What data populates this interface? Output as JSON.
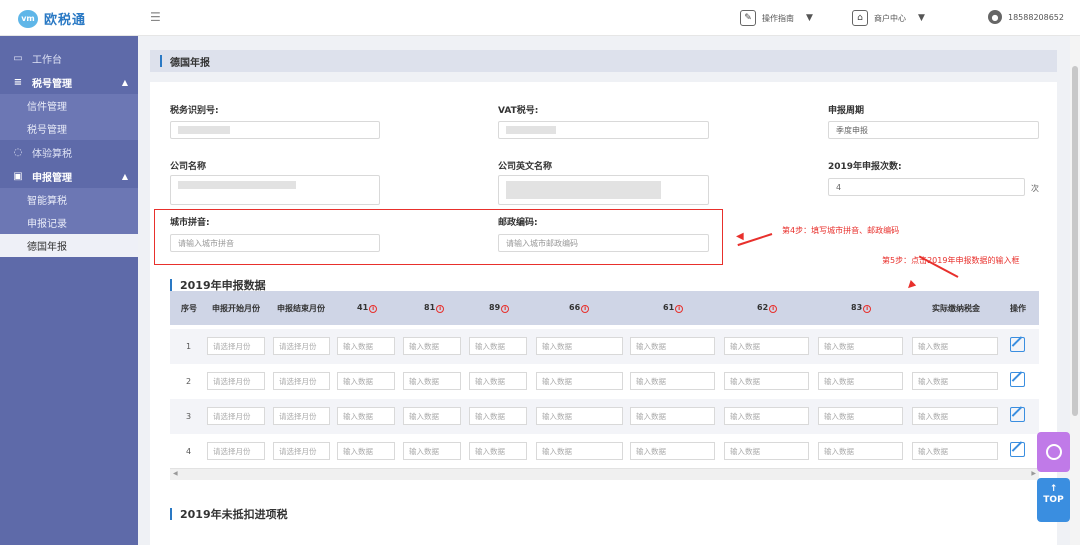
{
  "app": {
    "logo_mark": "vm",
    "name": "欧税通"
  },
  "header": {
    "guide_label": "操作指南",
    "merchant_label": "商户中心",
    "phone": "18588208652"
  },
  "sidebar": {
    "items": [
      {
        "label": "工作台",
        "icon": "monitor-icon"
      },
      {
        "label": "税号管理",
        "icon": "tax-icon"
      },
      {
        "label": "信件管理"
      },
      {
        "label": "税号管理"
      },
      {
        "label": "体验算税",
        "icon": "bulb-icon"
      },
      {
        "label": "申报管理",
        "icon": "report-icon"
      },
      {
        "label": "智能算税"
      },
      {
        "label": "申报记录"
      },
      {
        "label": "德国年报"
      }
    ]
  },
  "page": {
    "title": "德国年报"
  },
  "form": {
    "tax_id_label": "税务识别号:",
    "vat_label": "VAT税号:",
    "period_label": "申报周期",
    "period_value": "季度申报",
    "company_label": "公司名称",
    "company_en_label": "公司英文名称",
    "count_label": "2019年申报次数:",
    "count_value": "4",
    "count_unit": "次",
    "city_label": "城市拼音:",
    "city_placeholder": "请输入城市拼音",
    "postal_label": "邮政编码:",
    "postal_placeholder": "请输入城市邮政编码"
  },
  "annotations": {
    "step4": "第4步：填写城市拼音、邮政编码",
    "step5": "第5步：点击2019年申报数据的输入框"
  },
  "table": {
    "title": "2019年申报数据",
    "headers": [
      "序号",
      "申报开始月份",
      "申报结束月份",
      "41",
      "81",
      "89",
      "66",
      "61",
      "62",
      "83",
      "实际缴纳税金",
      "操作"
    ],
    "month_placeholder": "请选择月份",
    "data_placeholder": "输入数据",
    "rows": [
      "1",
      "2",
      "3",
      "4"
    ]
  },
  "section2": {
    "title": "2019年未抵扣进项税"
  },
  "float": {
    "top_label": "TOP"
  }
}
